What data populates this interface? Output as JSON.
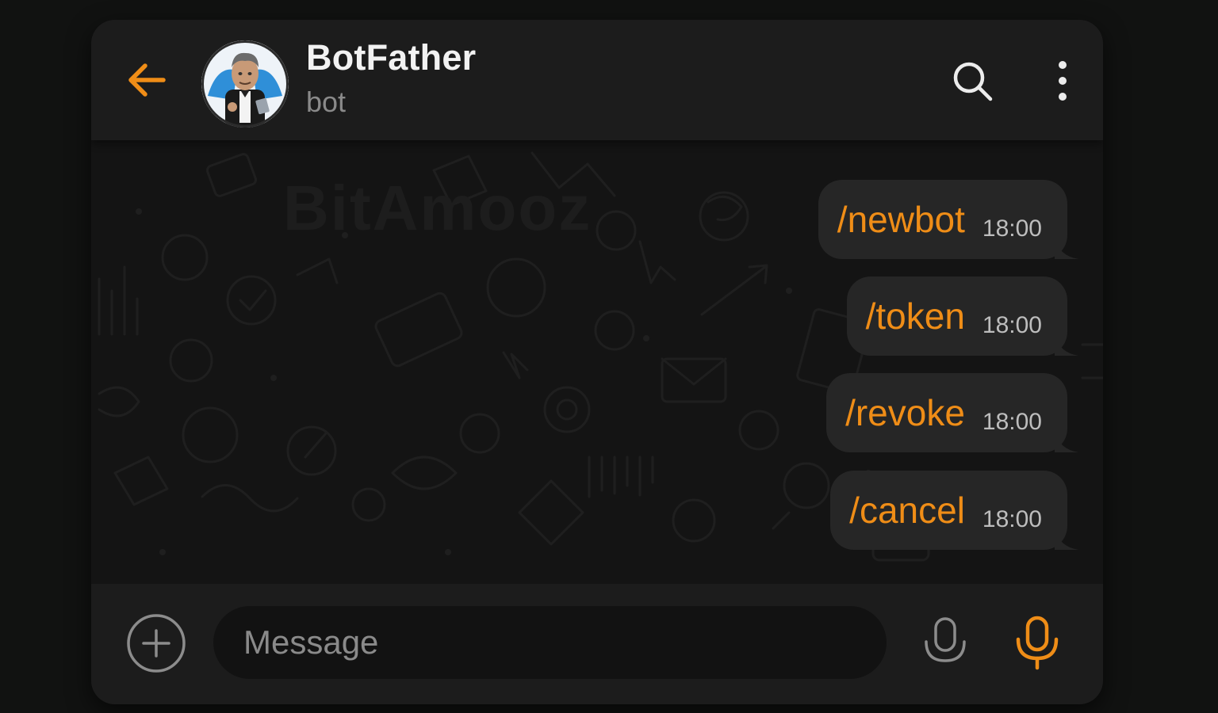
{
  "header": {
    "title": "BotFather",
    "subtitle": "bot",
    "back_icon": "arrow-left-icon",
    "search_icon": "search-icon",
    "menu_icon": "more-vertical-icon"
  },
  "wallpaper": {
    "watermark": "BitAmooz"
  },
  "messages": [
    {
      "text": "/newbot",
      "time": "18:00"
    },
    {
      "text": "/token",
      "time": "18:00"
    },
    {
      "text": "/revoke",
      "time": "18:00"
    },
    {
      "text": "/cancel",
      "time": "18:00"
    }
  ],
  "input": {
    "placeholder": "Message",
    "value": ""
  },
  "colors": {
    "accent": "#ef8d17",
    "background": "#111211",
    "panel": "#1c1c1c",
    "bubble": "#262626"
  }
}
